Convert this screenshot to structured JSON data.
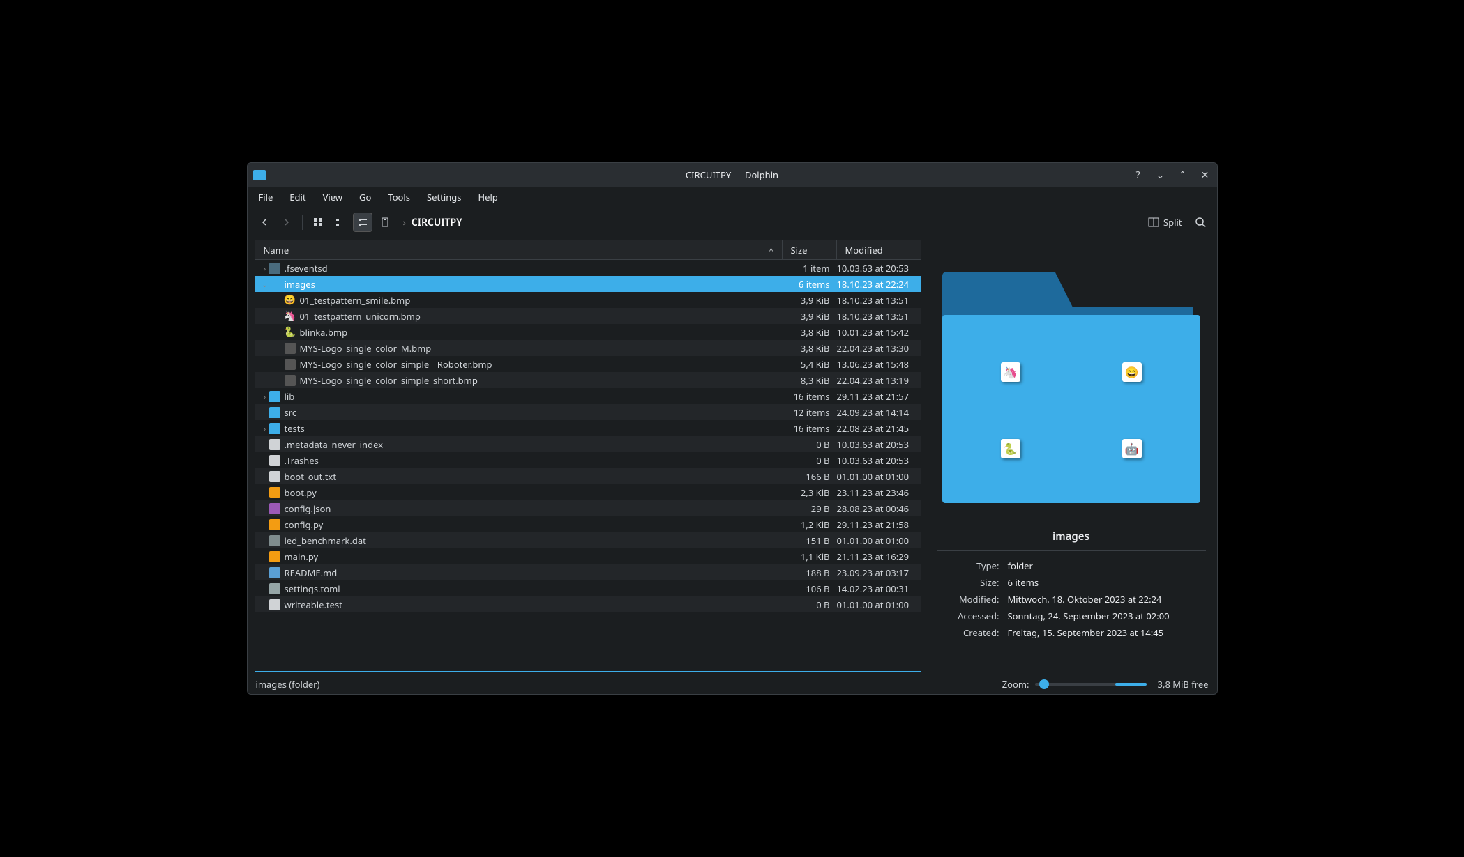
{
  "window": {
    "title": "CIRCUITPY — Dolphin"
  },
  "menubar": [
    "File",
    "Edit",
    "View",
    "Go",
    "Tools",
    "Settings",
    "Help"
  ],
  "toolbar": {
    "breadcrumb_current": "CIRCUITPY",
    "split_label": "Split"
  },
  "columns": {
    "name": "Name",
    "size": "Size",
    "modified": "Modified"
  },
  "files": [
    {
      "depth": 0,
      "expander": "›",
      "icon": "folder-dim",
      "name": ".fseventsd",
      "size": "1 item",
      "modified": "10.03.63 at 20:53"
    },
    {
      "depth": 0,
      "expander": "⌄",
      "icon": "folder",
      "name": "images",
      "size": "6 items",
      "modified": "18.10.23 at 22:24",
      "selected": true
    },
    {
      "depth": 1,
      "expander": "",
      "icon": "emoji",
      "emoji": "😄",
      "name": "01_testpattern_smile.bmp",
      "size": "3,9 KiB",
      "modified": "18.10.23 at 13:51"
    },
    {
      "depth": 1,
      "expander": "",
      "icon": "emoji",
      "emoji": "🦄",
      "name": "01_testpattern_unicorn.bmp",
      "size": "3,9 KiB",
      "modified": "18.10.23 at 13:51"
    },
    {
      "depth": 1,
      "expander": "",
      "icon": "emoji",
      "emoji": "🐍",
      "name": "blinka.bmp",
      "size": "3,8 KiB",
      "modified": "10.01.23 at 15:42"
    },
    {
      "depth": 1,
      "expander": "",
      "icon": "bmp",
      "name": "MYS-Logo_single_color_M.bmp",
      "size": "3,8 KiB",
      "modified": "22.04.23 at 13:30"
    },
    {
      "depth": 1,
      "expander": "",
      "icon": "bmp",
      "name": "MYS-Logo_single_color_simple__Roboter.bmp",
      "size": "5,4 KiB",
      "modified": "13.06.23 at 15:48"
    },
    {
      "depth": 1,
      "expander": "",
      "icon": "bmp",
      "name": "MYS-Logo_single_color_simple_short.bmp",
      "size": "8,3 KiB",
      "modified": "22.04.23 at 13:19"
    },
    {
      "depth": 0,
      "expander": "›",
      "icon": "folder",
      "name": "lib",
      "size": "16 items",
      "modified": "29.11.23 at 21:57"
    },
    {
      "depth": 0,
      "expander": "",
      "icon": "folder",
      "name": "src",
      "size": "12 items",
      "modified": "24.09.23 at 14:14"
    },
    {
      "depth": 0,
      "expander": "›",
      "icon": "folder",
      "name": "tests",
      "size": "16 items",
      "modified": "22.08.23 at 21:45"
    },
    {
      "depth": 0,
      "expander": "",
      "icon": "file-txt",
      "name": ".metadata_never_index",
      "size": "0 B",
      "modified": "10.03.63 at 20:53"
    },
    {
      "depth": 0,
      "expander": "",
      "icon": "file-txt",
      "name": ".Trashes",
      "size": "0 B",
      "modified": "10.03.63 at 20:53"
    },
    {
      "depth": 0,
      "expander": "",
      "icon": "file-txt",
      "name": "boot_out.txt",
      "size": "166 B",
      "modified": "01.01.00 at 01:00"
    },
    {
      "depth": 0,
      "expander": "",
      "icon": "file-py",
      "name": "boot.py",
      "size": "2,3 KiB",
      "modified": "23.11.23 at 23:46"
    },
    {
      "depth": 0,
      "expander": "",
      "icon": "file-json",
      "name": "config.json",
      "size": "29 B",
      "modified": "28.08.23 at 00:46"
    },
    {
      "depth": 0,
      "expander": "",
      "icon": "file-py",
      "name": "config.py",
      "size": "1,2 KiB",
      "modified": "29.11.23 at 21:58"
    },
    {
      "depth": 0,
      "expander": "",
      "icon": "file-dat",
      "name": "led_benchmark.dat",
      "size": "151 B",
      "modified": "01.01.00 at 01:00"
    },
    {
      "depth": 0,
      "expander": "",
      "icon": "file-py",
      "name": "main.py",
      "size": "1,1 KiB",
      "modified": "21.11.23 at 16:29"
    },
    {
      "depth": 0,
      "expander": "",
      "icon": "file-md",
      "name": "README.md",
      "size": "188 B",
      "modified": "23.09.23 at 03:17"
    },
    {
      "depth": 0,
      "expander": "",
      "icon": "file-generic",
      "name": "settings.toml",
      "size": "106 B",
      "modified": "14.02.23 at 00:31"
    },
    {
      "depth": 0,
      "expander": "",
      "icon": "file-txt",
      "name": "writeable.test",
      "size": "0 B",
      "modified": "01.01.00 at 01:00"
    }
  ],
  "info": {
    "title": "images",
    "type_label": "Type:",
    "type_value": "folder",
    "size_label": "Size:",
    "size_value": "6 items",
    "modified_label": "Modified:",
    "modified_value": "Mittwoch, 18. Oktober 2023 at 22:24",
    "accessed_label": "Accessed:",
    "accessed_value": "Sonntag, 24. September 2023 at 02:00",
    "created_label": "Created:",
    "created_value": "Freitag, 15. September 2023 at 14:45"
  },
  "preview_thumbs": [
    "🦄",
    "😄",
    "🐍",
    "🤖"
  ],
  "statusbar": {
    "selection": "images (folder)",
    "zoom_label": "Zoom:",
    "free_space": "3,8 MiB free"
  }
}
